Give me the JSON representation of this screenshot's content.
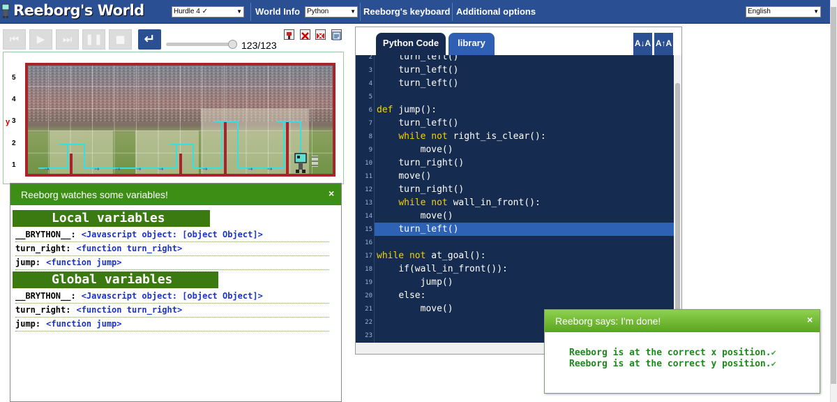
{
  "header": {
    "title": "Reeborg's World",
    "world_select": "Hurdle 4 ✓",
    "world_info": "World Info",
    "language_select": "Python",
    "keyboard": "Reeborg's keyboard",
    "additional_options": "Additional options",
    "ui_language": "English"
  },
  "controls": {
    "reverse_step_icon": "↵",
    "counter": "123/123"
  },
  "world": {
    "y_axis_label": "y",
    "y_ticks": [
      "5",
      "4",
      "3",
      "2",
      "1"
    ]
  },
  "variables_panel": {
    "title": "Reeborg watches some variables!",
    "close": "×",
    "local_heading": "Local variables",
    "global_heading": "Global variables",
    "local": [
      {
        "name": "__BRYTHON__:",
        "value": "<Javascript object: [object Object]>"
      },
      {
        "name": "turn_right:",
        "value": "<function turn_right>"
      },
      {
        "name": "jump:",
        "value": "<function jump>"
      }
    ],
    "global": [
      {
        "name": "__BRYTHON__:",
        "value": "<Javascript object: [object Object]>"
      },
      {
        "name": "turn_right:",
        "value": "<function turn_right>"
      },
      {
        "name": "jump:",
        "value": "<function jump>"
      }
    ]
  },
  "editor": {
    "tab_code": "Python Code",
    "tab_library": "library",
    "font_decrease": "A↓A",
    "font_increase": "A↑A",
    "line_numbers": [
      "2",
      "3",
      "4",
      "5",
      "6",
      "7",
      "8",
      "9",
      "10",
      "11",
      "12",
      "13",
      "14",
      "15",
      "16",
      "17",
      "18",
      "19",
      "20",
      "21",
      "22",
      "23"
    ],
    "lines": [
      {
        "indent": "    ",
        "kw": "",
        "text": "turn_left()"
      },
      {
        "indent": "    ",
        "kw": "",
        "text": "turn_left()"
      },
      {
        "indent": "    ",
        "kw": "",
        "text": "turn_left()"
      },
      {
        "indent": "",
        "kw": "",
        "text": ""
      },
      {
        "indent": "",
        "kw": "def",
        "text": " jump():"
      },
      {
        "indent": "    ",
        "kw": "",
        "text": "turn_left()"
      },
      {
        "indent": "    ",
        "kw": "while not",
        "text": " right_is_clear():"
      },
      {
        "indent": "        ",
        "kw": "",
        "text": "move()"
      },
      {
        "indent": "    ",
        "kw": "",
        "text": "turn_right()"
      },
      {
        "indent": "    ",
        "kw": "",
        "text": "move()"
      },
      {
        "indent": "    ",
        "kw": "",
        "text": "turn_right()"
      },
      {
        "indent": "    ",
        "kw": "while not",
        "text": " wall_in_front():"
      },
      {
        "indent": "        ",
        "kw": "",
        "text": "move()"
      },
      {
        "indent": "    ",
        "kw": "",
        "text": "turn_left()"
      },
      {
        "indent": "",
        "kw": "",
        "text": ""
      },
      {
        "indent": "",
        "kw": "while not",
        "text": " at_goal():"
      },
      {
        "indent": "    ",
        "kw": "",
        "text": "if(wall_in_front()):"
      },
      {
        "indent": "        ",
        "kw": "",
        "text": "jump()"
      },
      {
        "indent": "    ",
        "kw": "",
        "text": "else:"
      },
      {
        "indent": "        ",
        "kw": "",
        "text": "move()"
      },
      {
        "indent": "",
        "kw": "",
        "text": ""
      },
      {
        "indent": "",
        "kw": "",
        "text": ""
      }
    ],
    "highlighted_line": "15"
  },
  "done_dialog": {
    "title": "Reeborg says: I'm done!",
    "close": "×",
    "messages": [
      "Reeborg is at the correct x position.",
      "Reeborg is at the correct y position."
    ],
    "check": "✔"
  }
}
